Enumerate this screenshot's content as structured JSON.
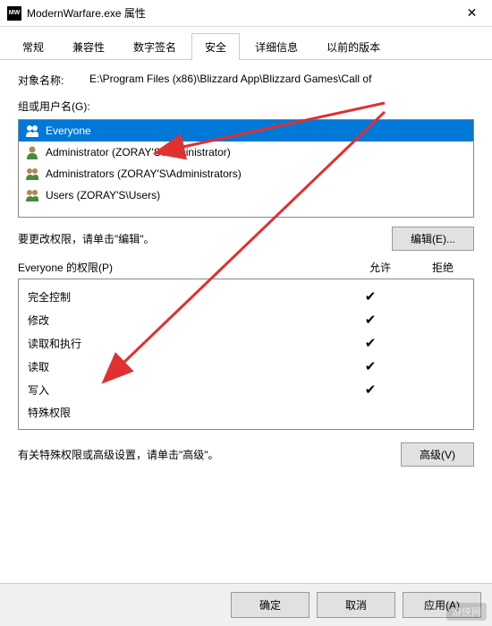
{
  "window": {
    "title": "ModernWarfare.exe 属性",
    "close_glyph": "✕"
  },
  "tabs": [
    {
      "label": "常规",
      "active": false
    },
    {
      "label": "兼容性",
      "active": false
    },
    {
      "label": "数字签名",
      "active": false
    },
    {
      "label": "安全",
      "active": true
    },
    {
      "label": "详细信息",
      "active": false
    },
    {
      "label": "以前的版本",
      "active": false
    }
  ],
  "security": {
    "object_label": "对象名称:",
    "object_path": "E:\\Program Files (x86)\\Blizzard App\\Blizzard Games\\Call of",
    "groups_label": "组或用户名(G):",
    "groups": [
      {
        "name": "Everyone",
        "selected": true,
        "icon": "group"
      },
      {
        "name": "Administrator (ZORAY'S\\Administrator)",
        "selected": false,
        "icon": "user"
      },
      {
        "name": "Administrators (ZORAY'S\\Administrators)",
        "selected": false,
        "icon": "group"
      },
      {
        "name": "Users (ZORAY'S\\Users)",
        "selected": false,
        "icon": "group"
      }
    ],
    "edit_hint": "要更改权限，请单击\"编辑\"。",
    "edit_button": "编辑(E)...",
    "perm_label": "Everyone 的权限(P)",
    "perm_allow": "允许",
    "perm_deny": "拒绝",
    "permissions": [
      {
        "name": "完全控制",
        "allow": true,
        "deny": false
      },
      {
        "name": "修改",
        "allow": true,
        "deny": false
      },
      {
        "name": "读取和执行",
        "allow": true,
        "deny": false
      },
      {
        "name": "读取",
        "allow": true,
        "deny": false
      },
      {
        "name": "写入",
        "allow": true,
        "deny": false
      },
      {
        "name": "特殊权限",
        "allow": false,
        "deny": false
      }
    ],
    "adv_hint": "有关特殊权限或高级设置，请单击\"高级\"。",
    "adv_button": "高级(V)"
  },
  "buttons": {
    "ok": "确定",
    "cancel": "取消",
    "apply": "应用(A)"
  },
  "watermark": "游侠网"
}
